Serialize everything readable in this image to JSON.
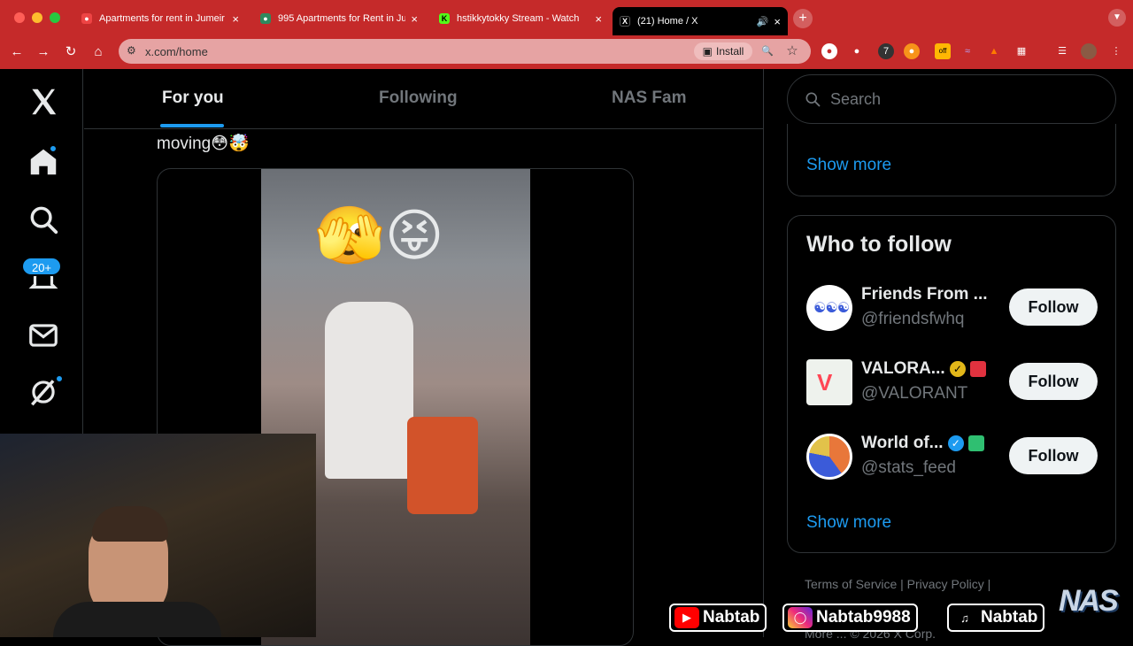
{
  "browser": {
    "tabs": [
      {
        "title": "Apartments for rent in Jumeir",
        "close": "×"
      },
      {
        "title": "995 Apartments for Rent in Ju",
        "close": "×"
      },
      {
        "title": "hstikkytokky Stream - Watch",
        "close": "×"
      },
      {
        "title": "(21) Home / X",
        "close": "×"
      }
    ],
    "new_tab": "+",
    "url": "x.com/home",
    "install_label": "Install",
    "ext_badges": {
      "seven": "7",
      "off": "off"
    }
  },
  "nav": {
    "notifications_badge": "20+"
  },
  "feed": {
    "tabs": [
      {
        "label": "For you"
      },
      {
        "label": "Following"
      },
      {
        "label": "NAS Fam"
      }
    ],
    "tweet_text": "moving😳🤯",
    "overlay_emojis": "🫣😝"
  },
  "sidebar": {
    "search_placeholder": "Search",
    "show_more": "Show more",
    "who_to_follow_title": "Who to follow",
    "accounts": [
      {
        "name": "Friends From ...",
        "handle": "@friendsfwhq",
        "follow": "Follow"
      },
      {
        "name": "VALORA...",
        "handle": "@VALORANT",
        "follow": "Follow"
      },
      {
        "name": "World of...",
        "handle": "@stats_feed",
        "follow": "Follow"
      }
    ],
    "show_more_2": "Show more",
    "footer_line1": "Terms of Service  |   Privacy Policy  |",
    "footer_line2": "More ...   © 2026 X Corp."
  },
  "overlay": {
    "youtube": "Nabtab",
    "instagram": "Nabtab9988",
    "tiktok": "Nabtab",
    "logo": "NAS"
  },
  "colors": {
    "browser_red": "#c52a2a",
    "x_blue": "#1d9bf0",
    "text_primary": "#e7e9ea",
    "text_secondary": "#71767b"
  }
}
